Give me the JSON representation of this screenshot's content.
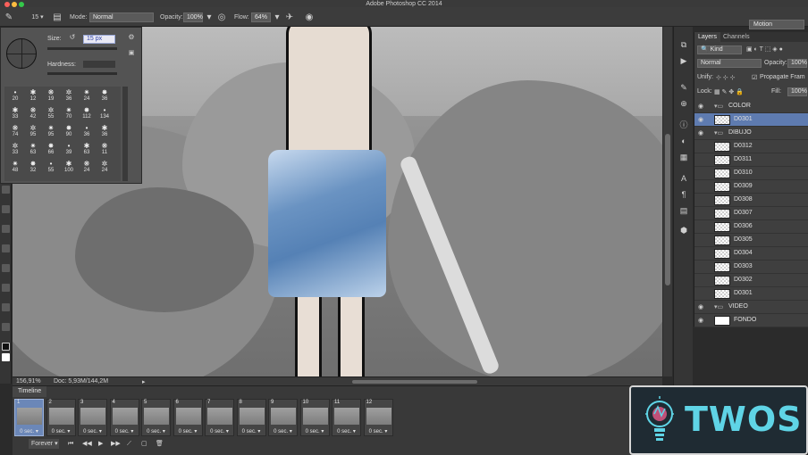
{
  "app": {
    "title": "Adobe Photoshop CC 2014"
  },
  "options_bar": {
    "brush_size": "15",
    "mode_label": "Mode:",
    "mode_value": "Normal",
    "opacity_label": "Opacity:",
    "opacity_value": "100%",
    "flow_label": "Flow:",
    "flow_value": "64%",
    "workspace": "Motion"
  },
  "brush_popup": {
    "size_label": "Size:",
    "size_value": "15 px",
    "hardness_label": "Hardness:",
    "presets": [
      [
        "20",
        "12",
        "19",
        "36",
        "24",
        "36"
      ],
      [
        "33",
        "42",
        "55",
        "70",
        "112",
        "134"
      ],
      [
        "74",
        "95",
        "95",
        "90",
        "36",
        "36"
      ],
      [
        "33",
        "63",
        "66",
        "39",
        "63",
        "11"
      ],
      [
        "48",
        "32",
        "55",
        "100",
        "24",
        "24"
      ]
    ]
  },
  "status": {
    "zoom": "156,91%",
    "doc": "Doc: 5,93M/144,2M"
  },
  "timeline": {
    "tab_label": "Timeline",
    "frames": [
      {
        "num": "1",
        "delay": "0 sec."
      },
      {
        "num": "2",
        "delay": "0 sec."
      },
      {
        "num": "3",
        "delay": "0 sec."
      },
      {
        "num": "4",
        "delay": "0 sec."
      },
      {
        "num": "5",
        "delay": "0 sec."
      },
      {
        "num": "6",
        "delay": "0 sec."
      },
      {
        "num": "7",
        "delay": "0 sec."
      },
      {
        "num": "8",
        "delay": "0 sec."
      },
      {
        "num": "9",
        "delay": "0 sec."
      },
      {
        "num": "10",
        "delay": "0 sec."
      },
      {
        "num": "11",
        "delay": "0 sec."
      },
      {
        "num": "12",
        "delay": "0 sec."
      }
    ],
    "loop": "Forever"
  },
  "layers_panel": {
    "tabs": [
      "Layers",
      "Channels"
    ],
    "filter_kind": "Kind",
    "blend_mode": "Normal",
    "opacity_label": "Opacity:",
    "opacity_value": "100%",
    "unify_label": "Unify:",
    "propagate_label": "Propagate Fram",
    "lock_label": "Lock:",
    "fill_label": "Fill:",
    "fill_value": "100%",
    "layers": [
      {
        "name": "COLOR",
        "type": "group"
      },
      {
        "name": "D0301",
        "type": "layer",
        "selected": true
      },
      {
        "name": "DIBUJO",
        "type": "group"
      },
      {
        "name": "D0312",
        "type": "layer"
      },
      {
        "name": "D0311",
        "type": "layer"
      },
      {
        "name": "D0310",
        "type": "layer"
      },
      {
        "name": "D0309",
        "type": "layer"
      },
      {
        "name": "D0308",
        "type": "layer"
      },
      {
        "name": "D0307",
        "type": "layer"
      },
      {
        "name": "D0306",
        "type": "layer"
      },
      {
        "name": "D0305",
        "type": "layer"
      },
      {
        "name": "D0304",
        "type": "layer"
      },
      {
        "name": "D0303",
        "type": "layer"
      },
      {
        "name": "D0302",
        "type": "layer"
      },
      {
        "name": "D0301",
        "type": "layer"
      },
      {
        "name": "VIDEO",
        "type": "group"
      },
      {
        "name": "FONDO",
        "type": "layer",
        "white": true
      }
    ]
  },
  "logo": {
    "text": "TWOS"
  },
  "colors": {
    "accent": "#5e7bb0",
    "logo_text": "#5fd4e6"
  }
}
